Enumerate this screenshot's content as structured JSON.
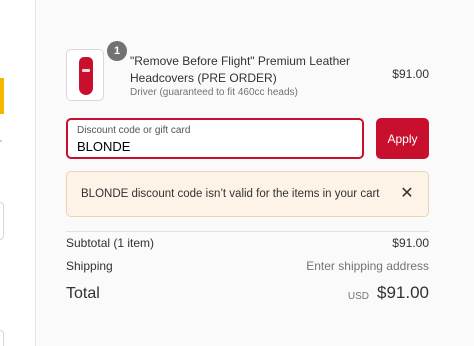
{
  "product": {
    "quantity": "1",
    "name": "\"Remove Before Flight\" Premium Leather Headcovers (PRE ORDER)",
    "variant": "Driver (guaranteed to fit 460cc heads)",
    "price": "$91.00",
    "image_icon": "red-headcover-image"
  },
  "discount": {
    "label": "Discount code or gift card",
    "value": "BLONDE",
    "apply_label": "Apply"
  },
  "error": {
    "message": "BLONDE discount code isn’t valid for the items in your cart",
    "close_symbol": "✕"
  },
  "summary": {
    "subtotal_label": "Subtotal (1 item)",
    "subtotal_value": "$91.00",
    "shipping_label": "Shipping",
    "shipping_value": "Enter shipping address",
    "total_label": "Total",
    "total_currency": "USD",
    "total_value": "$91.00"
  },
  "colors": {
    "accent": "#c8102e",
    "warning_bg": "#fdf3e6",
    "side_accent": "#f5b700"
  }
}
